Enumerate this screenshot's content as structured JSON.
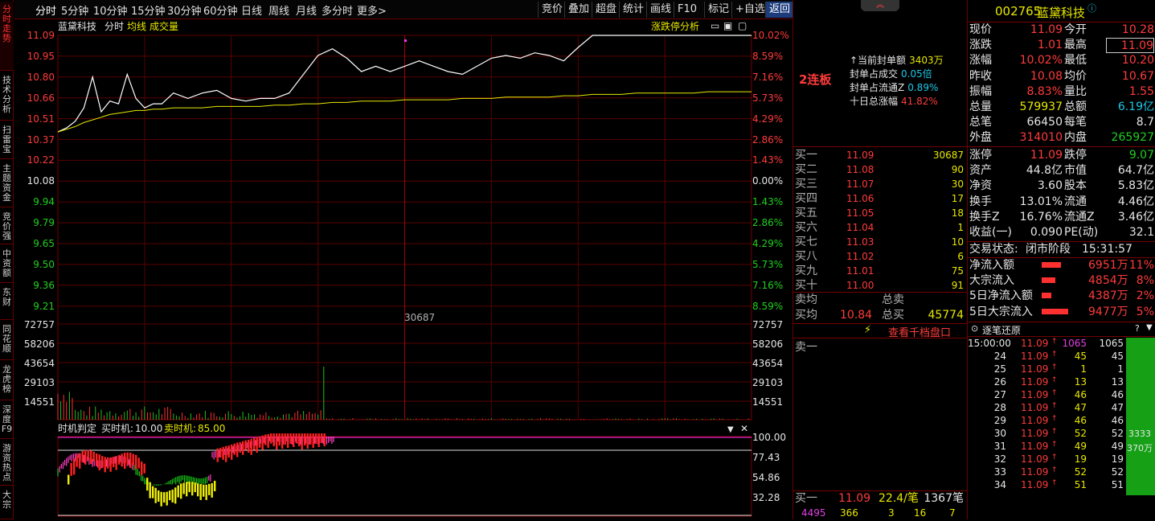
{
  "vtabs": [
    "分时走势",
    "技术分析",
    "扫雷宝",
    "主题资金",
    "竞价强",
    "中资额",
    "东财",
    "同花顺",
    "龙虎榜",
    "深度F9",
    "游资热点",
    "大宗"
  ],
  "toolbar": {
    "periods": [
      "分时",
      "5分钟",
      "10分钟",
      "15分钟",
      "30分钟",
      "60分钟",
      "日线",
      "周线",
      "月线",
      "多分时",
      "更多>"
    ],
    "actions": [
      "竞价",
      "叠加",
      "超盘",
      "统计",
      "画线",
      "F10",
      "标记",
      "+自选",
      "返回"
    ]
  },
  "chart_header": {
    "name": "蓝黛科技",
    "mode": "分时",
    "avg_label": "均线",
    "vol_label": "成交量",
    "limit_btn": "涨跌停分析"
  },
  "price_axis_left": [
    "11.09",
    "10.95",
    "10.80",
    "10.66",
    "10.51",
    "10.37",
    "10.22",
    "10.08",
    "9.94",
    "9.79",
    "9.65",
    "9.50",
    "9.36",
    "9.21"
  ],
  "price_axis_right": [
    "10.02%",
    "8.59%",
    "7.16%",
    "5.73%",
    "4.29%",
    "2.86%",
    "1.43%",
    "0.00%",
    "1.43%",
    "2.86%",
    "4.29%",
    "5.73%",
    "7.16%",
    "8.59%"
  ],
  "vol_axis": [
    "72757",
    "58206",
    "43654",
    "29103",
    "14551"
  ],
  "vol_marker": "30687",
  "indicator": {
    "title": "时机判定",
    "v1_label": "买时机:",
    "v1": "10.00",
    "v2_label": "卖时机:",
    "v2": "85.00",
    "axis": [
      "100.00",
      "77.43",
      "54.86",
      "32.28"
    ]
  },
  "seal": {
    "board": "2连板",
    "rows": [
      {
        "label": "↑当前封单额",
        "value": "3403万"
      },
      {
        "label": "封单占成交",
        "value": "0.05倍"
      },
      {
        "label": "封单占流通Z",
        "value": "0.89%"
      },
      {
        "label": "十日总涨幅",
        "value": "41.82%"
      }
    ]
  },
  "orderbook": {
    "bids": [
      {
        "name": "买一",
        "price": "11.09",
        "vol": "30687"
      },
      {
        "name": "买二",
        "price": "11.08",
        "vol": "90"
      },
      {
        "name": "买三",
        "price": "11.07",
        "vol": "30"
      },
      {
        "name": "买四",
        "price": "11.06",
        "vol": "17"
      },
      {
        "name": "买五",
        "price": "11.05",
        "vol": "18"
      },
      {
        "name": "买六",
        "price": "11.04",
        "vol": "1"
      },
      {
        "name": "买七",
        "price": "11.03",
        "vol": "10"
      },
      {
        "name": "买八",
        "price": "11.02",
        "vol": "6"
      },
      {
        "name": "买九",
        "price": "11.01",
        "vol": "75"
      },
      {
        "name": "买十",
        "price": "11.00",
        "vol": "91"
      }
    ],
    "sell_avg_label": "卖均",
    "sell_total_label": "总卖",
    "buy_avg_label": "买均",
    "buy_avg": "10.84",
    "buy_total_label": "总买",
    "buy_total": "45774",
    "depth_link": "查看千档盘口",
    "sell1": "卖一",
    "bottom": {
      "label": "买一",
      "price": "11.09",
      "per": "22.4/笔",
      "count": "1367笔",
      "nums": [
        "4495",
        "366",
        "3",
        "16",
        "7"
      ]
    }
  },
  "quote": {
    "code": "002765",
    "name": "蓝黛科技",
    "rows": [
      [
        "现价",
        "11.09",
        "今开",
        "10.28"
      ],
      [
        "涨跌",
        "1.01",
        "最高",
        "11.09"
      ],
      [
        "涨幅",
        "10.02%",
        "最低",
        "10.20"
      ],
      [
        "昨收",
        "10.08",
        "均价",
        "10.67"
      ],
      [
        "振幅",
        "8.83%",
        "量比",
        "1.55"
      ],
      [
        "总量",
        "579937",
        "总额",
        "6.19亿"
      ],
      [
        "总笔",
        "66450",
        "每笔",
        "8.7"
      ],
      [
        "外盘",
        "314010",
        "内盘",
        "265927"
      ]
    ],
    "rows2": [
      [
        "涨停",
        "11.09",
        "跌停",
        "9.07"
      ],
      [
        "资产",
        "44.8亿",
        "市值",
        "64.7亿"
      ],
      [
        "净资",
        "3.60",
        "股本",
        "5.83亿"
      ],
      [
        "换手",
        "13.01%",
        "流通",
        "4.46亿"
      ],
      [
        "换手Z",
        "16.76%",
        "流通Z",
        "3.46亿"
      ],
      [
        "收益(一)",
        "0.090",
        "PE(动)",
        "32.1"
      ]
    ],
    "status_label": "交易状态:",
    "status": "闭市阶段",
    "time": "15:31:57",
    "flows": [
      {
        "label": "净流入额",
        "value": "6951万",
        "pct": "11%",
        "bar": 0.4
      },
      {
        "label": "大宗流入",
        "value": "4854万",
        "pct": "8%",
        "bar": 0.28
      },
      {
        "label": "5日净流入额",
        "value": "4387万",
        "pct": "2%",
        "bar": 0.2
      },
      {
        "label": "5日大宗流入",
        "value": "9477万",
        "pct": "5%",
        "bar": 0.55
      }
    ]
  },
  "ticks": {
    "title": "逐笔还原",
    "rows": [
      [
        "15:00:00",
        "11.09",
        "1065",
        "1065"
      ],
      [
        "24",
        "11.09",
        "45",
        "45"
      ],
      [
        "25",
        "11.09",
        "1",
        "1"
      ],
      [
        "26",
        "11.09",
        "13",
        "13"
      ],
      [
        "27",
        "11.09",
        "46",
        "46"
      ],
      [
        "28",
        "11.09",
        "47",
        "47"
      ],
      [
        "29",
        "11.09",
        "46",
        "46"
      ],
      [
        "30",
        "11.09",
        "52",
        "52"
      ],
      [
        "31",
        "11.09",
        "49",
        "49"
      ],
      [
        "32",
        "11.09",
        "19",
        "19"
      ],
      [
        "33",
        "11.09",
        "52",
        "52"
      ],
      [
        "34",
        "11.09",
        "51",
        "51"
      ]
    ],
    "side_vol": "3333",
    "side_amt": "370万"
  },
  "chart_data": {
    "type": "line",
    "title": "",
    "ylim": [
      9.07,
      11.09
    ],
    "prev_close": 10.08,
    "x": [
      0,
      3,
      6,
      9,
      12,
      15,
      18,
      21,
      24,
      27,
      30,
      33,
      36,
      40,
      45,
      50,
      55,
      60,
      65,
      70,
      75,
      80,
      85,
      90,
      95,
      100,
      105,
      110,
      115,
      120,
      125,
      130,
      135,
      140,
      145,
      150,
      155,
      160,
      165,
      170,
      175,
      180,
      185,
      190,
      195,
      200,
      205,
      210,
      215,
      220,
      225,
      230,
      235,
      240
    ],
    "series": [
      {
        "values": [
          10.37,
          10.4,
          10.45,
          10.55,
          10.78,
          10.52,
          10.6,
          10.58,
          10.8,
          10.62,
          10.55,
          10.58,
          10.58,
          10.66,
          10.62,
          10.66,
          10.68,
          10.62,
          10.6,
          10.62,
          10.62,
          10.66,
          10.8,
          10.94,
          10.99,
          10.92,
          10.82,
          10.86,
          10.82,
          10.86,
          10.9,
          10.86,
          10.82,
          10.8,
          10.86,
          10.92,
          10.94,
          10.92,
          10.96,
          10.94,
          10.9,
          11.0,
          11.09,
          11.09,
          11.09,
          11.09,
          11.09,
          11.09,
          11.09,
          11.09,
          11.09,
          11.09,
          11.09,
          11.09
        ]
      },
      {
        "values": [
          10.37,
          10.39,
          10.41,
          10.44,
          10.46,
          10.48,
          10.5,
          10.51,
          10.52,
          10.53,
          10.53,
          10.54,
          10.54,
          10.55,
          10.55,
          10.55,
          10.56,
          10.56,
          10.56,
          10.56,
          10.57,
          10.57,
          10.58,
          10.58,
          10.59,
          10.59,
          10.6,
          10.6,
          10.6,
          10.61,
          10.61,
          10.61,
          10.61,
          10.62,
          10.62,
          10.62,
          10.63,
          10.63,
          10.63,
          10.63,
          10.64,
          10.64,
          10.65,
          10.65,
          10.65,
          10.66,
          10.66,
          10.66,
          10.66,
          10.66,
          10.67,
          10.67,
          10.67,
          10.67
        ]
      }
    ]
  }
}
